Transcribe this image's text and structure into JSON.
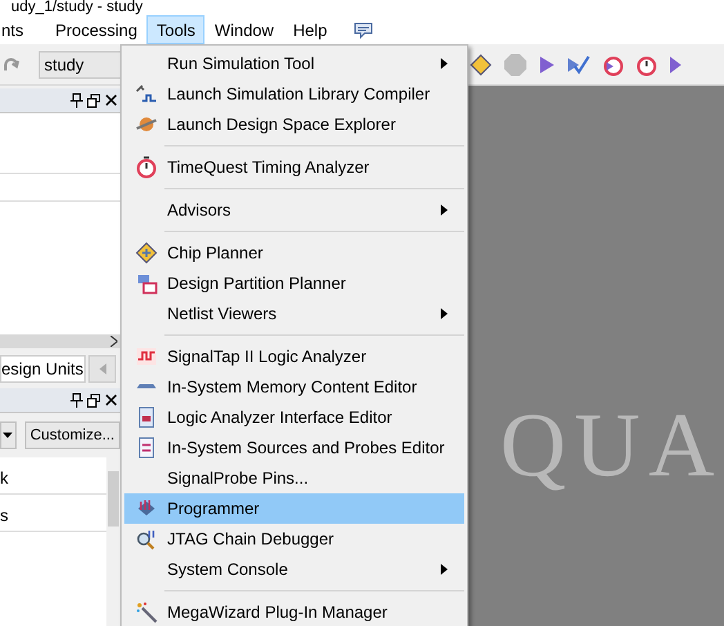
{
  "window": {
    "title": "udy_1/study - study"
  },
  "menubar": [
    {
      "label": "nts",
      "selected": false
    },
    {
      "label": "Processing",
      "selected": false
    },
    {
      "label": "Tools",
      "selected": true
    },
    {
      "label": "Window",
      "selected": false
    },
    {
      "label": "Help",
      "selected": false
    }
  ],
  "toolbar": {
    "project_combo": "study"
  },
  "left_panel": {
    "tab": "esign Units",
    "button": "Customize...",
    "rows": [
      "k",
      "s"
    ]
  },
  "tools_menu": [
    {
      "kind": "item",
      "label": "Run Simulation Tool",
      "icon": false,
      "submenu": true,
      "selected": false
    },
    {
      "kind": "item",
      "label": "Launch Simulation Library Compiler",
      "icon": true,
      "submenu": false,
      "selected": false
    },
    {
      "kind": "item",
      "label": "Launch Design Space Explorer",
      "icon": true,
      "submenu": false,
      "selected": false
    },
    {
      "kind": "separator"
    },
    {
      "kind": "item",
      "label": "TimeQuest Timing Analyzer",
      "icon": true,
      "submenu": false,
      "selected": false
    },
    {
      "kind": "separator"
    },
    {
      "kind": "item",
      "label": "Advisors",
      "icon": false,
      "submenu": true,
      "selected": false
    },
    {
      "kind": "separator"
    },
    {
      "kind": "item",
      "label": "Chip Planner",
      "icon": true,
      "submenu": false,
      "selected": false
    },
    {
      "kind": "item",
      "label": "Design Partition Planner",
      "icon": true,
      "submenu": false,
      "selected": false
    },
    {
      "kind": "item",
      "label": "Netlist Viewers",
      "icon": false,
      "submenu": true,
      "selected": false
    },
    {
      "kind": "separator"
    },
    {
      "kind": "item",
      "label": "SignalTap II Logic Analyzer",
      "icon": true,
      "submenu": false,
      "selected": false
    },
    {
      "kind": "item",
      "label": "In-System Memory Content Editor",
      "icon": true,
      "submenu": false,
      "selected": false
    },
    {
      "kind": "item",
      "label": "Logic Analyzer Interface Editor",
      "icon": true,
      "submenu": false,
      "selected": false
    },
    {
      "kind": "item",
      "label": "In-System Sources and Probes Editor",
      "icon": true,
      "submenu": false,
      "selected": false
    },
    {
      "kind": "item",
      "label": "SignalProbe Pins...",
      "icon": false,
      "submenu": false,
      "selected": false
    },
    {
      "kind": "item",
      "label": "Programmer",
      "icon": true,
      "submenu": false,
      "selected": true
    },
    {
      "kind": "item",
      "label": "JTAG Chain Debugger",
      "icon": true,
      "submenu": false,
      "selected": false
    },
    {
      "kind": "item",
      "label": "System Console",
      "icon": false,
      "submenu": true,
      "selected": false
    },
    {
      "kind": "separator"
    },
    {
      "kind": "item",
      "label": "MegaWizard Plug-In Manager",
      "icon": true,
      "submenu": false,
      "selected": false
    }
  ],
  "splash": {
    "text": "QUA"
  }
}
